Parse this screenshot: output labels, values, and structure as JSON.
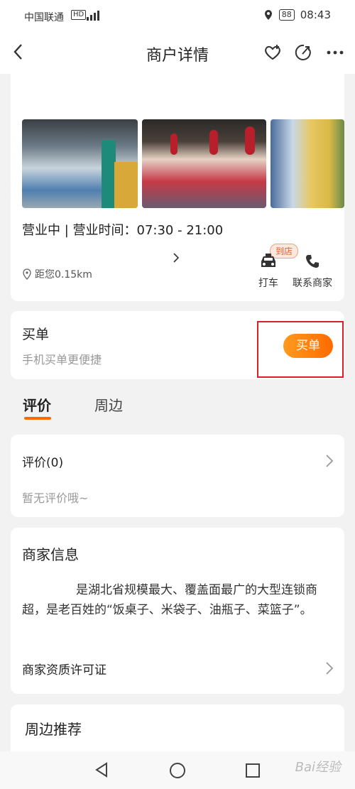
{
  "status_bar": {
    "carrier": "中国联通",
    "network": "HD",
    "signal": "4G",
    "battery": "88",
    "time": "08:43"
  },
  "header": {
    "title": "商户详情"
  },
  "store": {
    "hours": "营业中 | 营业时间：07:30 - 21:00",
    "distance": "距您0.15km",
    "badge": "到店",
    "taxi_label": "打车",
    "contact_label": "联系商家"
  },
  "pay": {
    "title": "买单",
    "subtitle": "手机买单更便捷",
    "button": "买单"
  },
  "tabs": [
    {
      "label": "评价"
    },
    {
      "label": "周边"
    }
  ],
  "reviews": {
    "title": "评价(0)",
    "empty": "暂无评价哦~"
  },
  "merchant": {
    "title": "商家信息",
    "desc": "是湖北省规模最大、覆盖面最广的大型连锁商超，是老百姓的“饭桌子、米袋子、油瓶子、菜篮子”。",
    "license": "商家资质许可证"
  },
  "nearby": {
    "title": "周边推荐"
  },
  "watermark": "Bai经验",
  "colors": {
    "accent": "#ff6a00",
    "highlight": "#d8202a"
  }
}
